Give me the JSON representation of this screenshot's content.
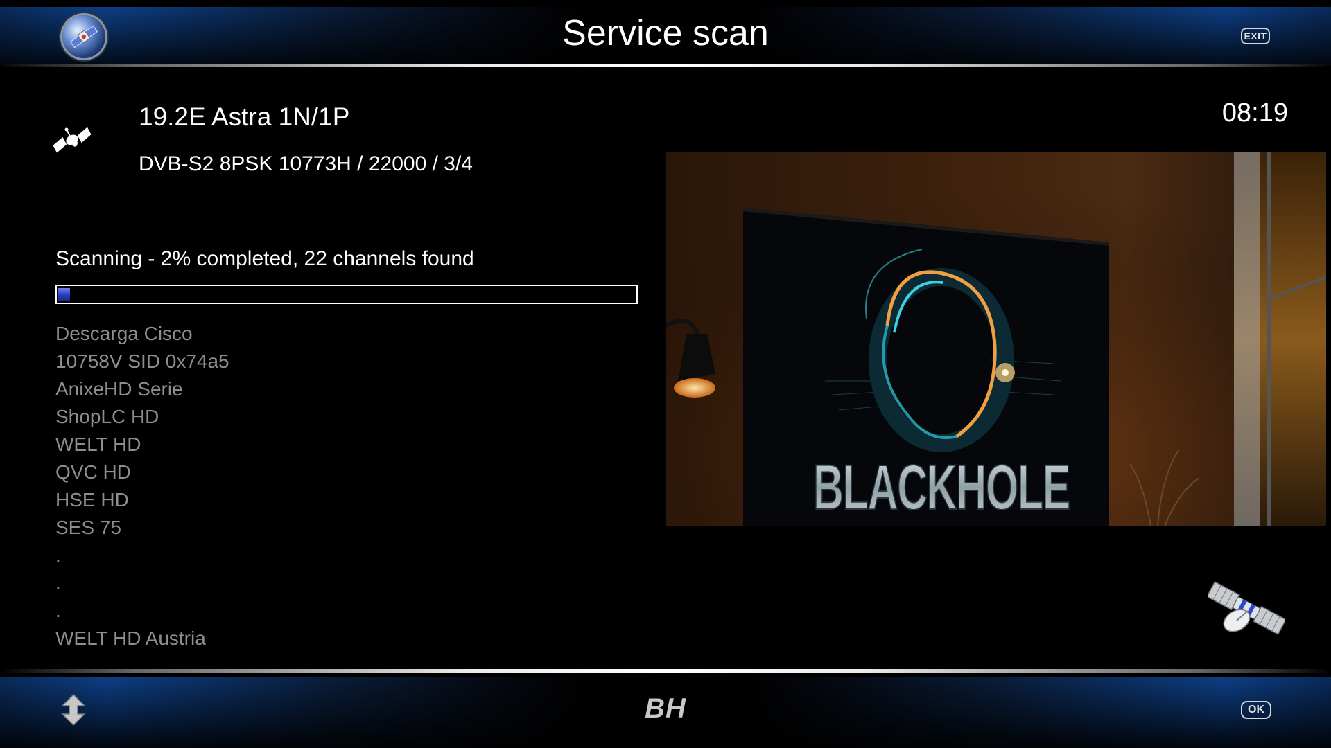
{
  "header": {
    "title": "Service scan",
    "exit_label": "EXIT",
    "left_icon": "globe-satellite-icon"
  },
  "satellite": {
    "name": "19.2E Astra 1N/1P",
    "transponder": "DVB-S2 8PSK 10773H / 22000 / 3/4",
    "icon": "satellite-icon"
  },
  "clock": "08:19",
  "scan": {
    "status": "Scanning - 2% completed, 22 channels found",
    "progress_percent": 2
  },
  "channels": [
    "Descarga Cisco",
    "10758V SID 0x74a5",
    "AnixeHD Serie",
    "ShopLC HD",
    "WELT HD",
    "QVC HD",
    "HSE HD",
    "SES 75",
    ".",
    ".",
    ".",
    "WELT HD Austria"
  ],
  "preview": {
    "logo_text": "BLACKHOLE"
  },
  "footer": {
    "logo": "BH",
    "ok_label": "OK",
    "left_icon": "up-down-arrows-icon",
    "right_icon": "satellite-dish-icon"
  },
  "colors": {
    "bar_blue": "#0d3f86",
    "progress_fill": "#2a3cc0",
    "list_text": "#8e8e8e"
  }
}
